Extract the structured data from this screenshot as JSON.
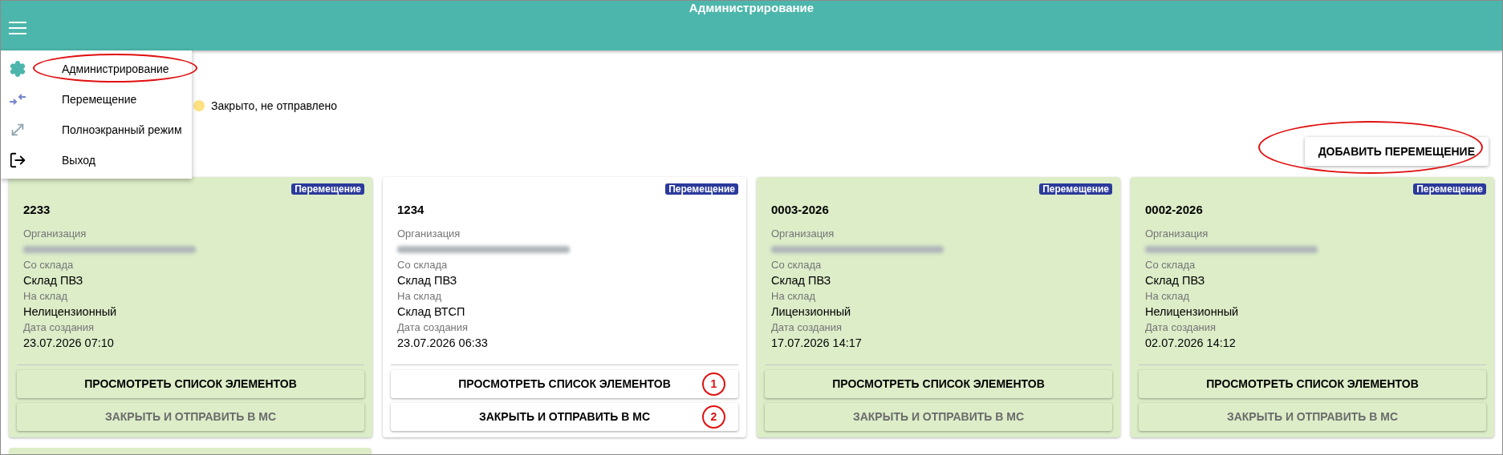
{
  "header": {
    "title": "Администрирование"
  },
  "menu": {
    "items": [
      {
        "kind": "gear",
        "label": "Администрирование",
        "highlighted": true
      },
      {
        "kind": "transfer",
        "label": "Перемещение",
        "highlighted": false
      },
      {
        "kind": "expand",
        "label": "Полноэкранный режим",
        "highlighted": false
      },
      {
        "kind": "logout",
        "label": "Выход",
        "highlighted": false
      }
    ]
  },
  "legend": [
    {
      "label": "Закрыто, не отправлено",
      "color": "#ffe082"
    }
  ],
  "add_button": {
    "label": "ДОБАВИТЬ ПЕРЕМЕЩЕНИЕ",
    "highlighted": true
  },
  "cards": [
    {
      "badge": "Перемещение",
      "number": "2233",
      "closed": true,
      "fields": [
        {
          "label": "Организация",
          "redacted": true
        },
        {
          "label": "Со склада",
          "value": "Склад ПВЗ"
        },
        {
          "label": "На склад",
          "value": "Нелицензионный"
        },
        {
          "label": "Дата создания",
          "value": "23.07.2026 07:10"
        }
      ],
      "buttons": [
        {
          "label": "ПРОСМОТРЕТЬ СПИСОК ЭЛЕМЕНТОВ",
          "disabled": false
        },
        {
          "label": "ЗАКРЫТЬ И ОТПРАВИТЬ В МС",
          "disabled": true
        }
      ]
    },
    {
      "badge": "Перемещение",
      "number": "1234",
      "closed": false,
      "fields": [
        {
          "label": "Организация",
          "redacted": true
        },
        {
          "label": "Со склада",
          "value": "Склад ПВЗ"
        },
        {
          "label": "На склад",
          "value": "Склад ВТСП"
        },
        {
          "label": "Дата создания",
          "value": "23.07.2026 06:33"
        }
      ],
      "buttons": [
        {
          "label": "ПРОСМОТРЕТЬ СПИСОК ЭЛЕМЕНТОВ",
          "disabled": false,
          "marker": "1"
        },
        {
          "label": "ЗАКРЫТЬ И ОТПРАВИТЬ В МС",
          "disabled": false,
          "marker": "2"
        }
      ]
    },
    {
      "badge": "Перемещение",
      "number": "0003-2026",
      "closed": true,
      "fields": [
        {
          "label": "Организация",
          "redacted": true
        },
        {
          "label": "Со склада",
          "value": "Склад ПВЗ"
        },
        {
          "label": "На склад",
          "value": "Лицензионный"
        },
        {
          "label": "Дата создания",
          "value": "17.07.2026 14:17"
        }
      ],
      "buttons": [
        {
          "label": "ПРОСМОТРЕТЬ СПИСОК ЭЛЕМЕНТОВ",
          "disabled": false
        },
        {
          "label": "ЗАКРЫТЬ И ОТПРАВИТЬ В МС",
          "disabled": true
        }
      ]
    },
    {
      "badge": "Перемещение",
      "number": "0002-2026",
      "closed": true,
      "fields": [
        {
          "label": "Организация",
          "redacted": true
        },
        {
          "label": "Со склада",
          "value": "Склад ПВЗ"
        },
        {
          "label": "На склад",
          "value": "Нелицензионный"
        },
        {
          "label": "Дата создания",
          "value": "02.07.2026 14:12"
        }
      ],
      "buttons": [
        {
          "label": "ПРОСМОТРЕТЬ СПИСОК ЭЛЕМЕНТОВ",
          "disabled": false
        },
        {
          "label": "ЗАКРЫТЬ И ОТПРАВИТЬ В МС",
          "disabled": true
        }
      ]
    },
    {
      "closed": true
    }
  ]
}
